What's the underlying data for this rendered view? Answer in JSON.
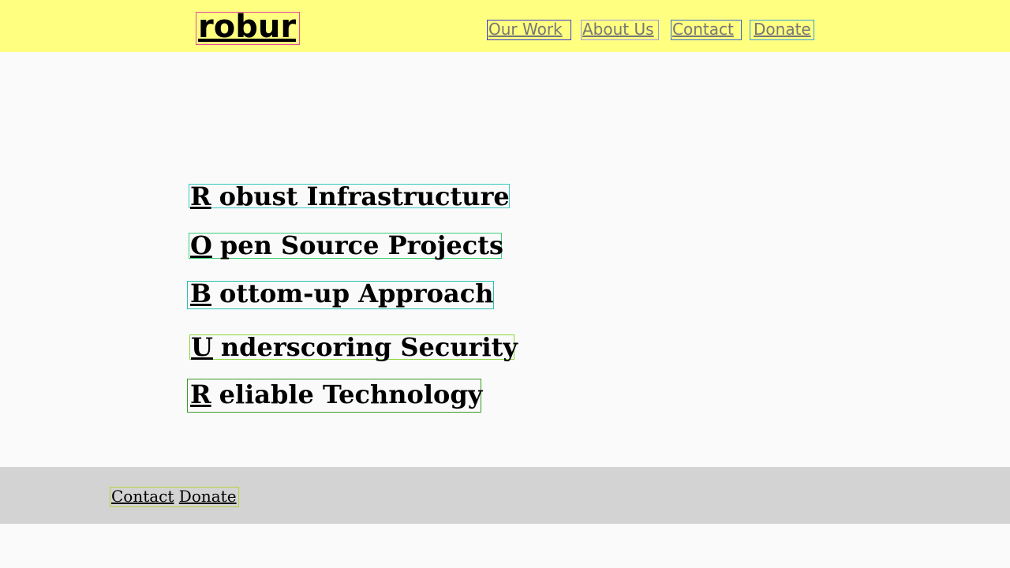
{
  "header": {
    "logo": "robur",
    "nav": [
      "Our Work",
      "About Us",
      "Contact",
      "Donate"
    ]
  },
  "main": {
    "items": [
      {
        "initial": "R",
        "rest": "obust Infrastructure"
      },
      {
        "initial": "O",
        "rest": "pen Source Projects"
      },
      {
        "initial": "B",
        "rest": "ottom-up Approach"
      },
      {
        "initial": "U",
        "rest": "nderscoring Security"
      },
      {
        "initial": "R",
        "rest": "eliable Technology"
      }
    ]
  },
  "footer": {
    "links": [
      "Contact",
      "Donate"
    ]
  },
  "colors": {
    "header_bg": "#ffff80",
    "page_bg": "#fafafa",
    "footer_bg": "#d3d3d3"
  }
}
